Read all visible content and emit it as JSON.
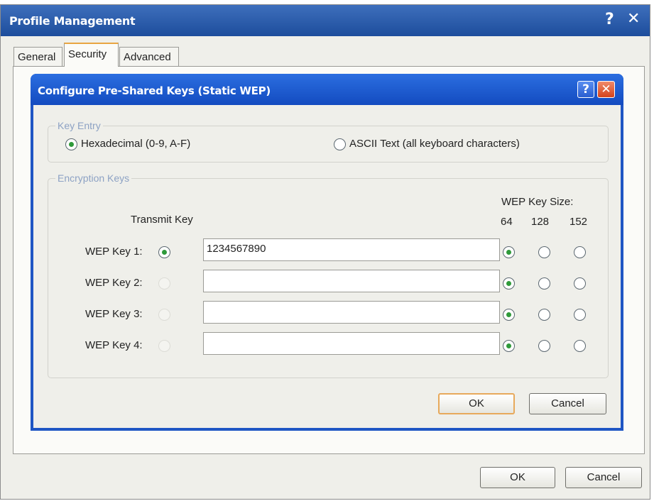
{
  "outer_window": {
    "title": "Profile Management",
    "help_glyph": "?",
    "close_glyph": "✕",
    "tabs": [
      {
        "label": "General",
        "active": false
      },
      {
        "label": "Security",
        "active": true
      },
      {
        "label": "Advanced",
        "active": false
      }
    ],
    "ok_label": "OK",
    "cancel_label": "Cancel"
  },
  "dialog": {
    "title": "Configure Pre-Shared Keys (Static WEP)",
    "help_glyph": "?",
    "close_glyph": "✕",
    "key_entry": {
      "legend": "Key Entry",
      "options": [
        {
          "label": "Hexadecimal (0-9, A-F)",
          "selected": true
        },
        {
          "label": "ASCII Text (all keyboard characters)",
          "selected": false
        }
      ]
    },
    "encryption_keys": {
      "legend": "Encryption Keys",
      "transmit_key_header": "Transmit Key",
      "wep_key_size_header": "WEP Key Size:",
      "sizes": [
        "64",
        "128",
        "152"
      ],
      "keys": [
        {
          "label": "WEP Key 1:",
          "value": "1234567890",
          "transmit": true,
          "transmit_enabled": true,
          "size": "64"
        },
        {
          "label": "WEP Key 2:",
          "value": "",
          "transmit": false,
          "transmit_enabled": false,
          "size": "64"
        },
        {
          "label": "WEP Key 3:",
          "value": "",
          "transmit": false,
          "transmit_enabled": false,
          "size": "64"
        },
        {
          "label": "WEP Key 4:",
          "value": "",
          "transmit": false,
          "transmit_enabled": false,
          "size": "64"
        }
      ]
    },
    "ok_label": "OK",
    "cancel_label": "Cancel"
  },
  "colors": {
    "outer_titlebar": "#1d4d9c",
    "dialog_titlebar": "#134bc0",
    "close_button": "#d4431c",
    "radio_checked": "#2f9a3a",
    "legend_text": "#8da2c4",
    "default_button_border": "#e7a95b"
  }
}
